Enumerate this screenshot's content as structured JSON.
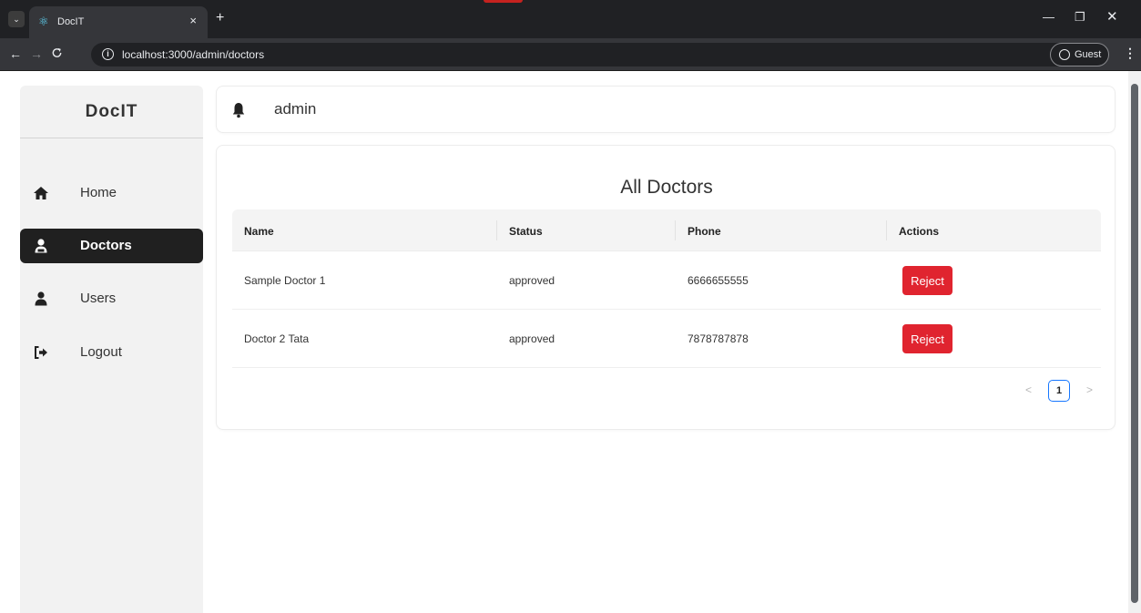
{
  "browser": {
    "tab_title": "DocIT",
    "tab_close": "×",
    "new_tab": "+",
    "url": "localhost:3000/admin/doctors",
    "profile_label": "Guest",
    "window_controls": {
      "minimize": "—",
      "maximize": "❐",
      "close": "✕"
    },
    "nav": {
      "back": "←",
      "forward": "→",
      "reload": "C"
    }
  },
  "sidebar": {
    "brand": "DocIT",
    "items": [
      {
        "label": "Home",
        "icon": "home-icon",
        "active": false
      },
      {
        "label": "Doctors",
        "icon": "doctor-icon",
        "active": true
      },
      {
        "label": "Users",
        "icon": "user-icon",
        "active": false
      },
      {
        "label": "Logout",
        "icon": "logout-icon",
        "active": false
      }
    ]
  },
  "header": {
    "icon": "bell-icon",
    "username": "admin"
  },
  "main": {
    "title": "All Doctors",
    "table": {
      "columns": [
        "Name",
        "Status",
        "Phone",
        "Actions"
      ],
      "rows": [
        {
          "name": "Sample Doctor 1",
          "status": "approved",
          "phone": "6666655555",
          "action": "Reject"
        },
        {
          "name": "Doctor 2 Tata",
          "status": "approved",
          "phone": "7878787878",
          "action": "Reject"
        }
      ]
    },
    "pagination": {
      "prev": "<",
      "current": "1",
      "next": ">"
    }
  },
  "colors": {
    "active_menu_bg": "#202020",
    "reject_button": "#e0242f",
    "pagination_accent": "#1677ff",
    "sidebar_bg": "#f2f2f2"
  }
}
